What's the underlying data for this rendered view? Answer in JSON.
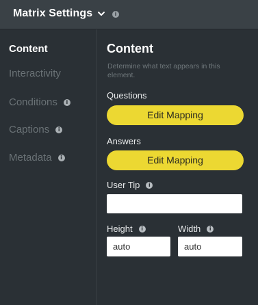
{
  "header": {
    "title": "Matrix Settings",
    "info": "i"
  },
  "sidebar": {
    "items": [
      {
        "label": "Content",
        "active": true
      },
      {
        "label": "Interactivity",
        "active": false
      },
      {
        "label": "Conditions",
        "active": false,
        "info": "i"
      },
      {
        "label": "Captions",
        "active": false,
        "info": "i"
      },
      {
        "label": "Metadata",
        "active": false,
        "info": "i"
      }
    ]
  },
  "main": {
    "title": "Content",
    "description": "Determine what text appears in this element.",
    "questions": {
      "label": "Questions",
      "button_label": "Edit Mapping"
    },
    "answers": {
      "label": "Answers",
      "button_label": "Edit Mapping"
    },
    "user_tip": {
      "label": "User Tip",
      "info": "i",
      "value": ""
    },
    "height": {
      "label": "Height",
      "info": "i",
      "value": "auto"
    },
    "width": {
      "label": "Width",
      "info": "i",
      "value": "auto"
    }
  },
  "colors": {
    "accent": "#ecd832",
    "background": "#2a3035",
    "header": "#3a4146"
  }
}
